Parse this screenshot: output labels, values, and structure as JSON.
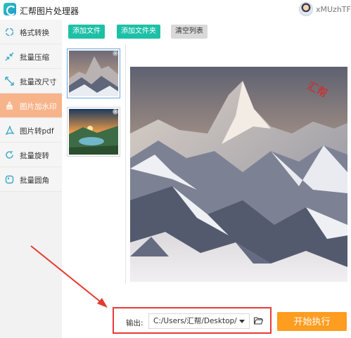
{
  "app": {
    "title": "汇帮图片处理器",
    "user_name": "xMUzhTFb"
  },
  "sidebar": {
    "items": [
      {
        "label": "格式转换",
        "icon": "format-convert-icon",
        "active": false
      },
      {
        "label": "批量压缩",
        "icon": "compress-icon",
        "active": false
      },
      {
        "label": "批量改尺寸",
        "icon": "resize-icon",
        "active": false
      },
      {
        "label": "图片加水印",
        "icon": "watermark-icon",
        "active": true
      },
      {
        "label": "图片转pdf",
        "icon": "pdf-icon",
        "active": false
      },
      {
        "label": "批量旋转",
        "icon": "rotate-icon",
        "active": false
      },
      {
        "label": "批量圆角",
        "icon": "round-corner-icon",
        "active": false
      }
    ]
  },
  "toolbar": {
    "add_file": "添加文件",
    "add_folder": "添加文件夹",
    "clear_list": "清空列表"
  },
  "preview": {
    "watermark_text": "汇帮"
  },
  "output": {
    "label": "输出:",
    "path": "C:/Users/汇帮/Desktop/",
    "folder_icon": "folder-open-icon"
  },
  "actions": {
    "start": "开始执行"
  },
  "colors": {
    "accent": "#1dc0a6",
    "active_item": "#f7b48a",
    "start_button": "#ff9d21",
    "highlight_box": "#e73b3b",
    "arrow": "#e53a2f"
  }
}
